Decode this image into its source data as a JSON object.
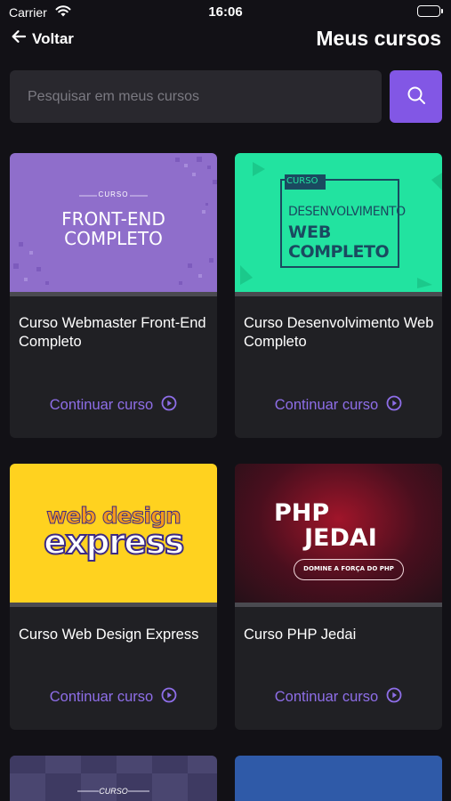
{
  "status_bar": {
    "carrier": "Carrier",
    "time": "16:06"
  },
  "nav": {
    "back_label": "Voltar",
    "title": "Meus cursos"
  },
  "search": {
    "placeholder": "Pesquisar em meus cursos"
  },
  "colors": {
    "accent": "#8257e5",
    "link": "#8e6ee8",
    "background": "#121116",
    "card": "#202024"
  },
  "courses": [
    {
      "title": "Curso Webmaster Front-End Completo",
      "thumb_small": "CURSO",
      "thumb_line1": "FRONT-END",
      "thumb_line2": "COMPLETO",
      "cta": "Continuar curso"
    },
    {
      "title": "Curso Desenvolvimento Web Completo",
      "thumb_small": "CURSO",
      "thumb_line1": "DESENVOLVIMENTO",
      "thumb_line2": "WEB",
      "thumb_line3": "COMPLETO",
      "cta": "Continuar curso"
    },
    {
      "title": "Curso Web Design Express",
      "thumb_line1": "web design",
      "thumb_line2": "express",
      "cta": "Continuar curso"
    },
    {
      "title": "Curso PHP Jedai",
      "thumb_line1": "PHP",
      "thumb_line2": "JEDAI",
      "thumb_tag": "DOMINE A FORÇA DO PHP",
      "cta": "Continuar curso"
    },
    {
      "thumb_small": "CURSO"
    },
    {}
  ]
}
